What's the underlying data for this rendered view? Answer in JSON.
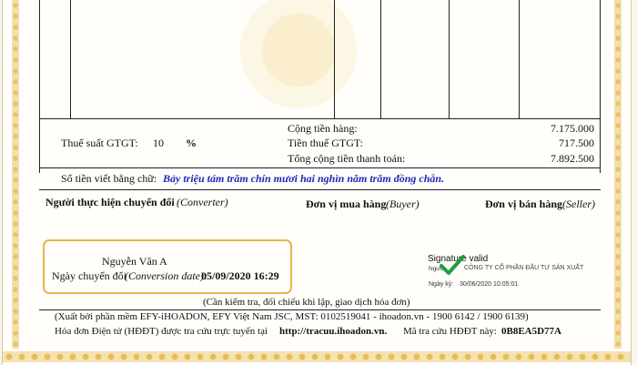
{
  "invoice": {
    "totals": {
      "goods_label": "Cộng tiền hàng:",
      "goods_value": "7.175.000",
      "vat_rate_label": "Thuế suất GTGT:",
      "vat_rate_value": "10",
      "vat_rate_unit": "%",
      "vat_label": "Tiền thuế GTGT:",
      "vat_value": "717.500",
      "total_label": "Tổng cộng tiền thanh toán:",
      "total_value": "7.892.500"
    },
    "amount_words": {
      "label": "Số tiền viết bằng chữ:",
      "value": "Bảy triệu tám trăm chín mươi hai nghìn năm trăm đồng chẵn."
    },
    "parties": {
      "converter_label": "Người thực hiện chuyển đổi",
      "converter_en": "(Converter)",
      "buyer_label": "Đơn vị mua hàng",
      "buyer_en": "(Buyer)",
      "seller_label": "Đơn vị bán hàng",
      "seller_en": "(Seller)"
    },
    "conversion": {
      "name": "Nguyễn Văn A",
      "date_label": "Ngày chuyển đổi",
      "date_en": "(Conversion date):",
      "date_value": "05/09/2020 16:29"
    },
    "signature": {
      "valid_label": "Signature valid",
      "signed_by_label": "Ngườ",
      "signed_by_value": "CÔNG TY CỔ PHẦN ĐẦU TƯ SẢN XUẤT",
      "signed_date_label": "Ngày ký:",
      "signed_date_value": "30/06/2020 10:05:01"
    },
    "notes": {
      "check_note": "(Cần kiểm tra, đối chiếu khi lập, giao dịch hóa đơn)",
      "software_line": "(Xuất bởi phần mềm EFY-iHOADON, EFY Việt Nam JSC, MST: 0102519041 - ihoadon.vn - 1900 6142 / 1900 6139)",
      "lookup_text": "Hóa đơn Điện tử (HĐĐT) được tra cứu trực tuyến tại",
      "lookup_url": "http://tracuu.ihoadon.vn.",
      "lookup_code_label": "Mã tra cứu HĐĐT này:",
      "lookup_code_value": "0B8EA5D77A"
    }
  },
  "colors": {
    "accent_blue": "#1f27b7",
    "highlight_border": "#e8b54a",
    "check_green": "#1d9d3d",
    "border_gold": "#e6bb5a"
  }
}
